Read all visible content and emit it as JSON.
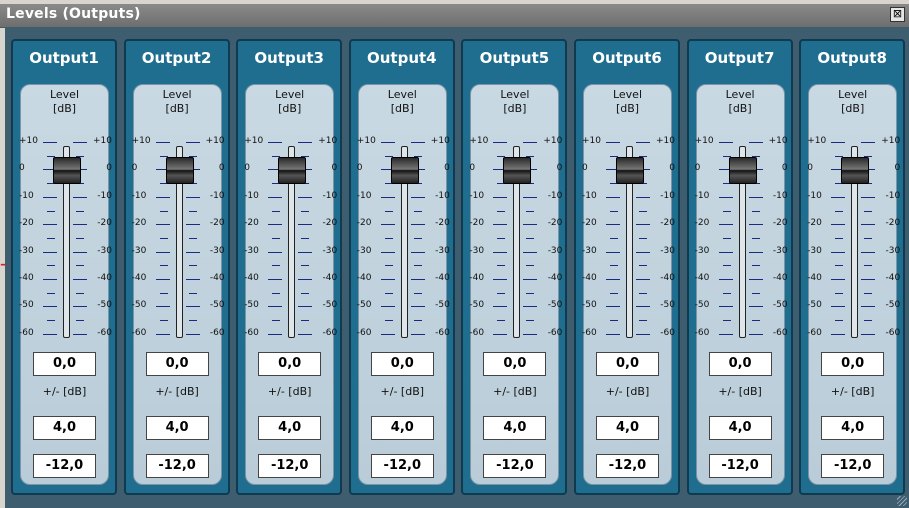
{
  "window": {
    "title": "Levels (Outputs)",
    "close_glyph": "⊠"
  },
  "indicator_glyph": "→",
  "colors": {
    "accent": "#1f6d8f",
    "panel": "#3e5d6f"
  },
  "channels": [
    {
      "name": "Output1",
      "level_label": "Level",
      "level_unit": "[dB]",
      "gain": "0,0",
      "range_label": "+/- [dB]",
      "range": "4,0",
      "min": "-12,0"
    },
    {
      "name": "Output2",
      "level_label": "Level",
      "level_unit": "[dB]",
      "gain": "0,0",
      "range_label": "+/- [dB]",
      "range": "4,0",
      "min": "-12,0"
    },
    {
      "name": "Output3",
      "level_label": "Level",
      "level_unit": "[dB]",
      "gain": "0,0",
      "range_label": "+/- [dB]",
      "range": "4,0",
      "min": "-12,0"
    },
    {
      "name": "Output4",
      "level_label": "Level",
      "level_unit": "[dB]",
      "gain": "0,0",
      "range_label": "+/- [dB]",
      "range": "4,0",
      "min": "-12,0"
    },
    {
      "name": "Output5",
      "level_label": "Level",
      "level_unit": "[dB]",
      "gain": "0,0",
      "range_label": "+/- [dB]",
      "range": "4,0",
      "min": "-12,0"
    },
    {
      "name": "Output6",
      "level_label": "Level",
      "level_unit": "[dB]",
      "gain": "0,0",
      "range_label": "+/- [dB]",
      "range": "4,0",
      "min": "-12,0"
    },
    {
      "name": "Output7",
      "level_label": "Level",
      "level_unit": "[dB]",
      "gain": "0,0",
      "range_label": "+/- [dB]",
      "range": "4,0",
      "min": "-12,0"
    },
    {
      "name": "Output8",
      "level_label": "Level",
      "level_unit": "[dB]",
      "gain": "0,0",
      "range_label": "+/- [dB]",
      "range": "4,0",
      "min": "-12,0"
    }
  ],
  "scale": [
    "+10",
    "0",
    "-10",
    "-20",
    "-30",
    "-40",
    "-50",
    "-60"
  ],
  "fader_value_db": 0
}
